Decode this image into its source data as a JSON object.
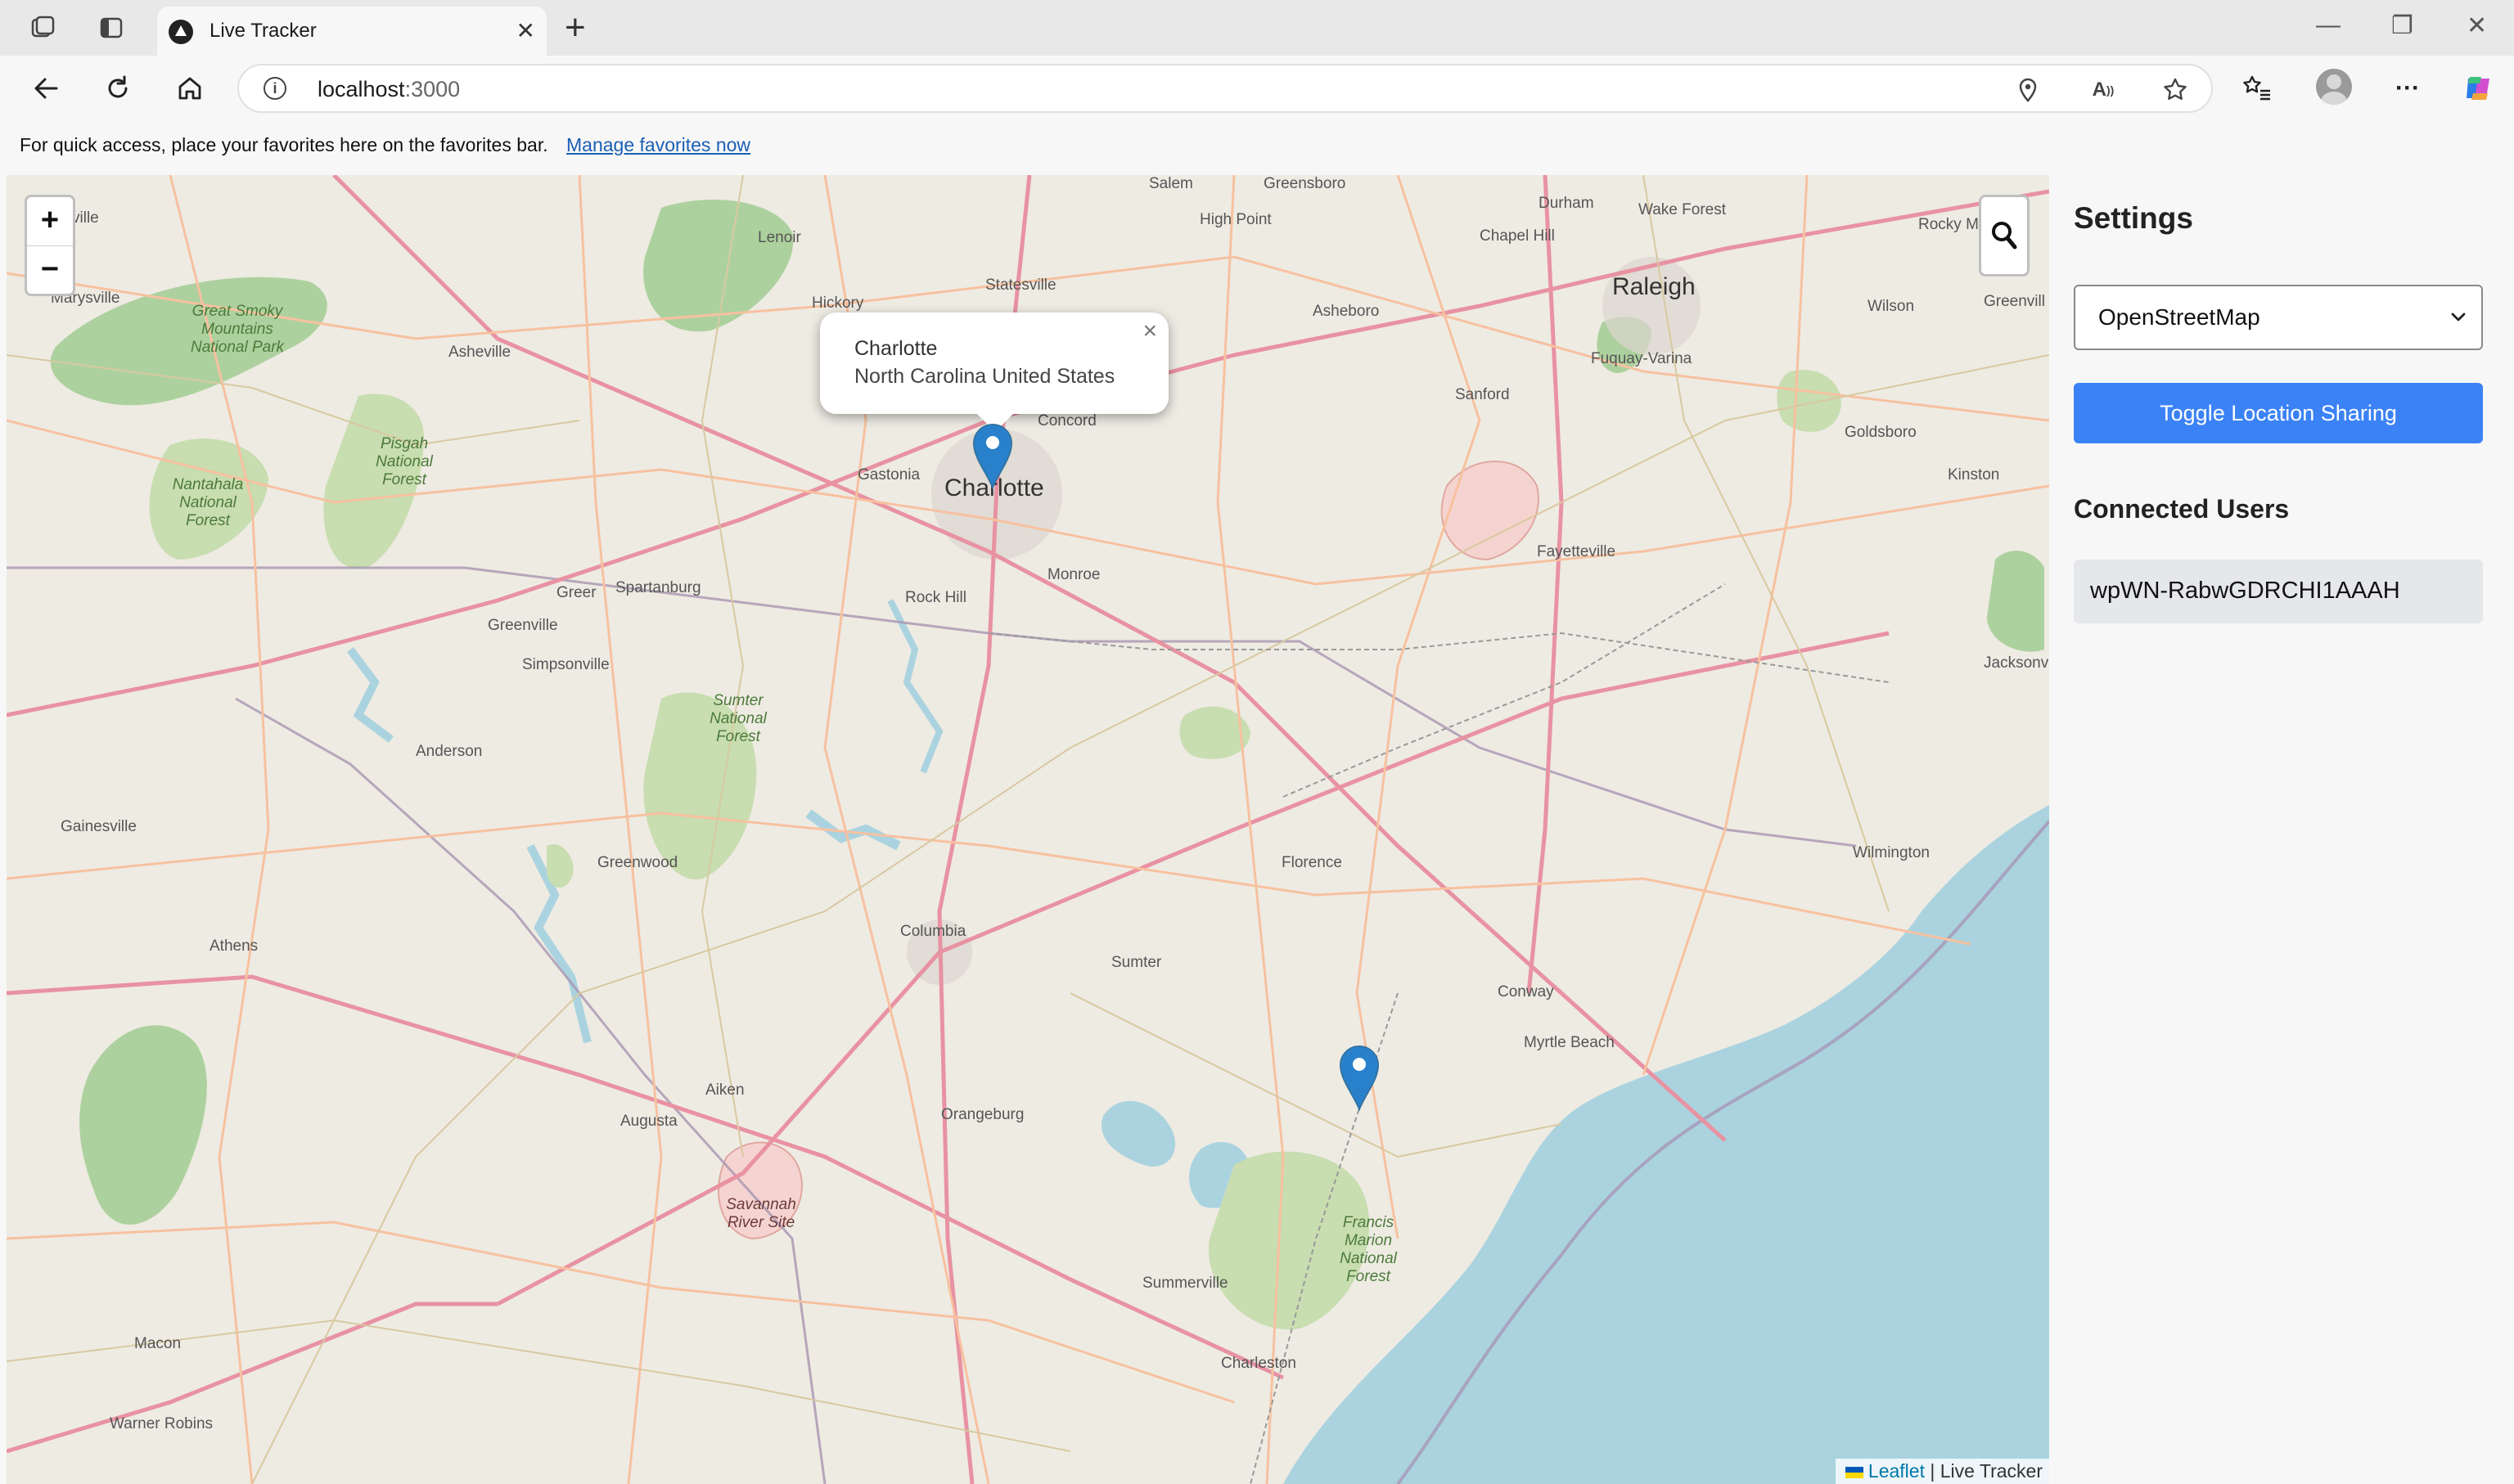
{
  "browser": {
    "tab_title": "Live Tracker",
    "url_host": "localhost",
    "url_port": ":3000",
    "favorites_text": "For quick access, place your favorites here on the favorites bar.",
    "favorites_link": "Manage favorites now"
  },
  "map": {
    "zoom_in": "+",
    "zoom_out": "−",
    "popup": {
      "title": "Charlotte",
      "subtitle": "North Carolina United States",
      "close": "×"
    },
    "attribution": {
      "leaflet": "Leaflet",
      "separator": " | ",
      "app": "Live Tracker"
    },
    "labels": {
      "salem": "Salem",
      "greensboro": "Greensboro",
      "durham": "Durham",
      "wake_forest": "Wake Forest",
      "rocky_mount": "Rocky Mount",
      "high_point": "High Point",
      "chapel_hill": "Chapel Hill",
      "raleigh": "Raleigh",
      "lenoir": "Lenoir",
      "statesville": "Statesville",
      "hickory": "Hickory",
      "asheboro": "Asheboro",
      "wilson": "Wilson",
      "greenville": "Greenvill",
      "fuquay": "Fuquay-Varina",
      "sanford": "Sanford",
      "asheville": "Asheville",
      "concord": "Concord",
      "goldsboro": "Goldsboro",
      "kinston": "Kinston",
      "gastonia": "Gastonia",
      "charlotte": "Charlotte",
      "monroe": "Monroe",
      "fayetteville": "Fayetteville",
      "greer": "Greer",
      "spartanburg": "Spartanburg",
      "rock_hill": "Rock Hill",
      "greenville_sc": "Greenville",
      "simpsonville": "Simpsonville",
      "jacksonville": "Jacksonvill",
      "anderson": "Anderson",
      "gainesville": "Gainesville",
      "greenwood": "Greenwood",
      "florence": "Florence",
      "wilmington": "Wilmington",
      "columbia": "Columbia",
      "athens": "Athens",
      "sumter": "Sumter",
      "conway": "Conway",
      "myrtle_beach": "Myrtle Beach",
      "aiken": "Aiken",
      "augusta": "Augusta",
      "orangeburg": "Orangeburg",
      "summerville": "Summerville",
      "charleston": "Charleston",
      "macon": "Macon",
      "warner_robins": "Warner Robins",
      "ville": "ville",
      "marysville": "Marysville",
      "smoky": "Great Smoky Mountains National Park",
      "pisgah": "Pisgah National Forest",
      "nantahala": "Nantahala National Forest",
      "sumter_nf": "Sumter National Forest",
      "francis_marion": "Francis Marion National Forest",
      "savannah": "Savannah River Site"
    }
  },
  "sidebar": {
    "title": "Settings",
    "layer_select": "OpenStreetMap",
    "toggle_button": "Toggle Location Sharing",
    "connected_title": "Connected Users",
    "users": [
      "wpWN-RabwGDRCHI1AAAH"
    ]
  },
  "colors": {
    "accent": "#3b82f6",
    "marker": "#2a81cb",
    "water": "#aad3df",
    "forest": "#c8ddb0"
  }
}
